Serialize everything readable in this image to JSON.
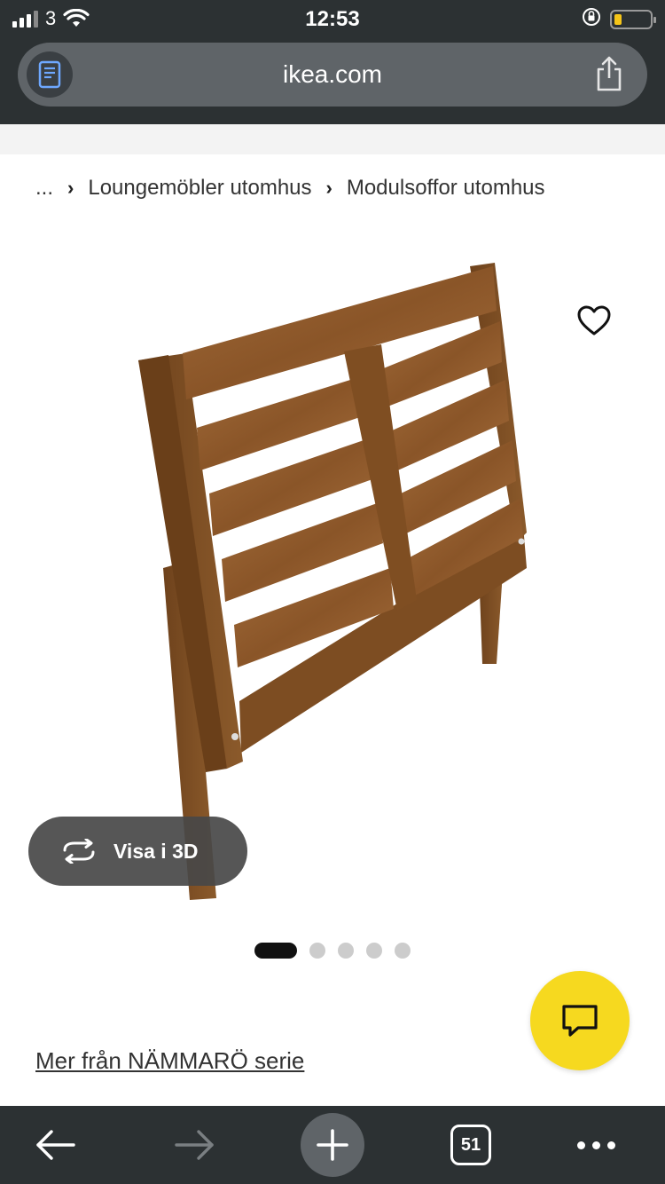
{
  "status_bar": {
    "carrier": "3",
    "time": "12:53"
  },
  "browser": {
    "url": "ikea.com",
    "tab_count": "51"
  },
  "breadcrumb": {
    "ellipsis": "...",
    "items": [
      "Loungemöbler utomhus",
      "Modulsoffor utomhus"
    ]
  },
  "product": {
    "view_3d_label": "Visa i 3D",
    "gallery_total": 5,
    "gallery_current": 1
  },
  "series_link": "Mer från NÄMMARÖ serie",
  "colors": {
    "chrome": "#2c3133",
    "urlbar": "#5f6468",
    "chat_fab": "#f6d91f",
    "wood": "#8b5a2b"
  },
  "icons": [
    "reader-icon",
    "share-icon",
    "heart-icon",
    "rotate-3d-icon",
    "chat-icon",
    "back-arrow-icon",
    "forward-arrow-icon",
    "plus-icon",
    "more-icon"
  ]
}
